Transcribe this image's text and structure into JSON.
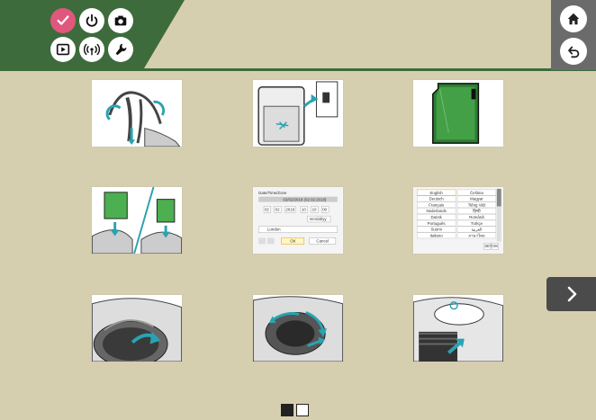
{
  "nav": {
    "icons": [
      "check-icon",
      "power-icon",
      "camera-icon",
      "playback-icon",
      "wireless-icon",
      "wrench-icon"
    ]
  },
  "rail": {
    "home": "home-icon",
    "back": "back-icon"
  },
  "tiles": {
    "strap": {},
    "charger": {},
    "sd_card": {},
    "battery_card": {},
    "datetime": {
      "title": "Date/Time/Zone",
      "date_display": "02/02/2018 (02:02:2018)",
      "day": "02",
      "month": "02",
      "year": "2018",
      "hour": "10",
      "minute": "10",
      "second": "00",
      "format": "mm/dd/yy",
      "zone": "London",
      "ok": "OK",
      "cancel": "Cancel"
    },
    "language": {
      "left": [
        "English",
        "Deutsch",
        "Français",
        "Nederlands",
        "Dansk",
        "Português",
        "Suomi",
        "Italiano"
      ],
      "right": [
        "Čeština",
        "Magyar",
        "Tiếng Việt",
        "हिन्दी",
        "Română",
        "Türkçe",
        "العربية",
        "ภาษาไทย"
      ],
      "set": "SET",
      "ok": "OK"
    },
    "lens_attach": {},
    "lens_hood": {},
    "lens_mount": {}
  },
  "pager": {
    "current": 1,
    "total": 2
  }
}
